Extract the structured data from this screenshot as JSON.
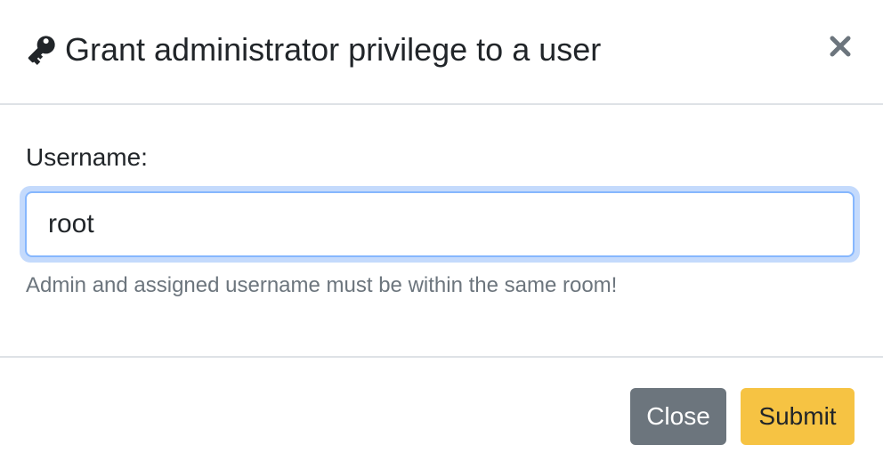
{
  "dialog": {
    "title": "Grant administrator privilege to a user",
    "title_icon": "key-icon",
    "close_icon": "close-icon"
  },
  "form": {
    "username_label": "Username:",
    "username_value": "root",
    "help_text": "Admin and assigned username must be within the same room!"
  },
  "footer": {
    "close_label": "Close",
    "submit_label": "Submit"
  },
  "colors": {
    "close_button": "#6c757d",
    "submit_button": "#f6c343",
    "input_focus_border": "#86b7fe",
    "text": "#212529",
    "muted_text": "#6c757d"
  }
}
